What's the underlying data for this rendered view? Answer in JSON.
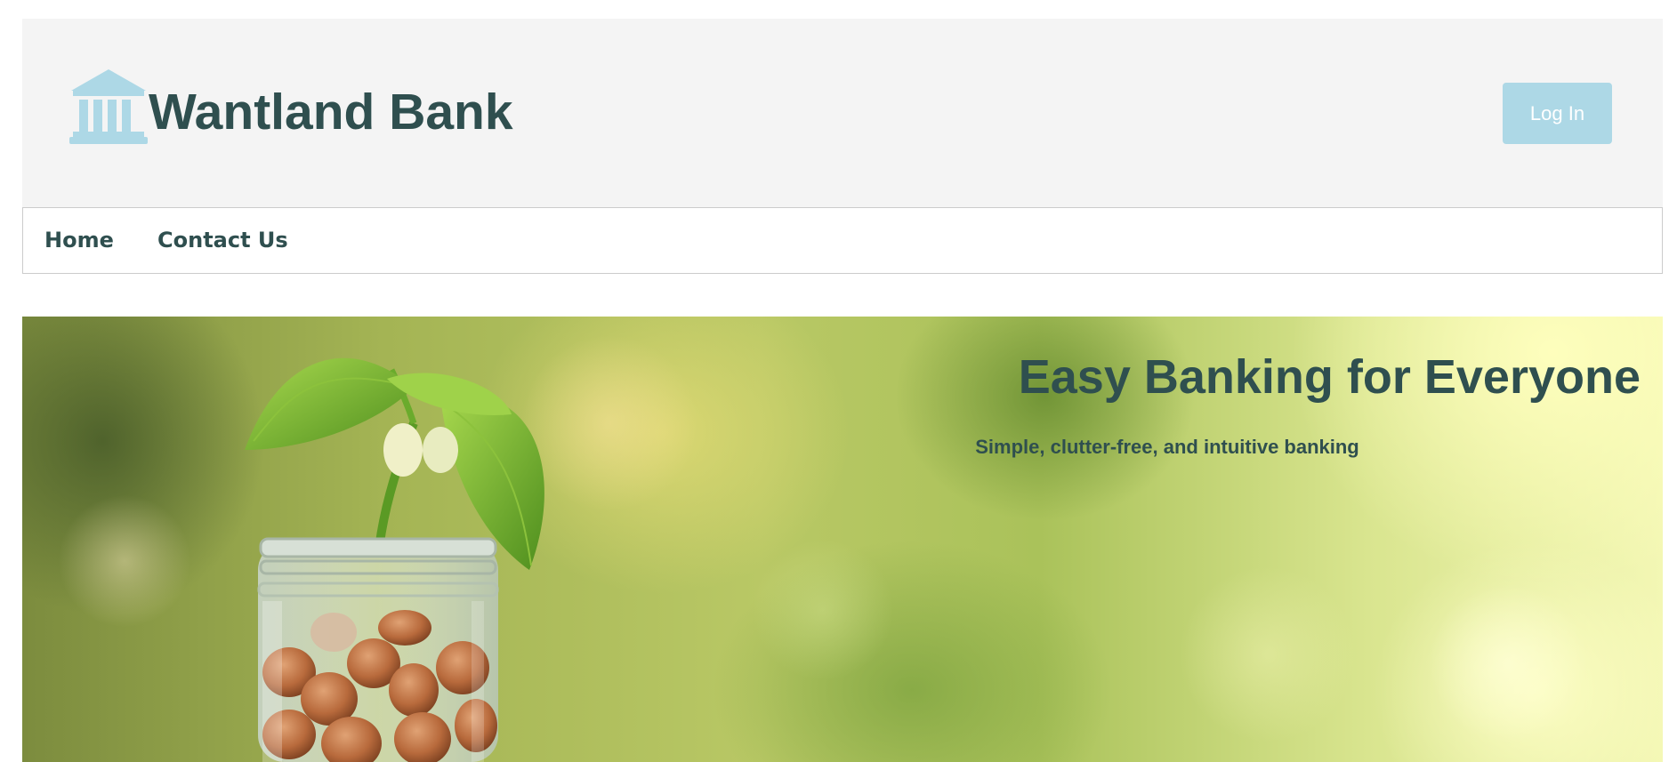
{
  "header": {
    "brand_name": "Wantland Bank",
    "logo_icon": "bank-building-icon",
    "login_label": "Log In"
  },
  "nav": {
    "items": [
      {
        "label": "Home"
      },
      {
        "label": "Contact Us"
      }
    ]
  },
  "hero": {
    "title": "Easy Banking for Everyone",
    "subtitle": "Simple, clutter-free, and intuitive banking",
    "image": "plant-sprouting-from-coin-jar"
  },
  "colors": {
    "text": "#2f4f4f",
    "accent": "#add8e6",
    "header_bg": "#f4f4f4"
  }
}
